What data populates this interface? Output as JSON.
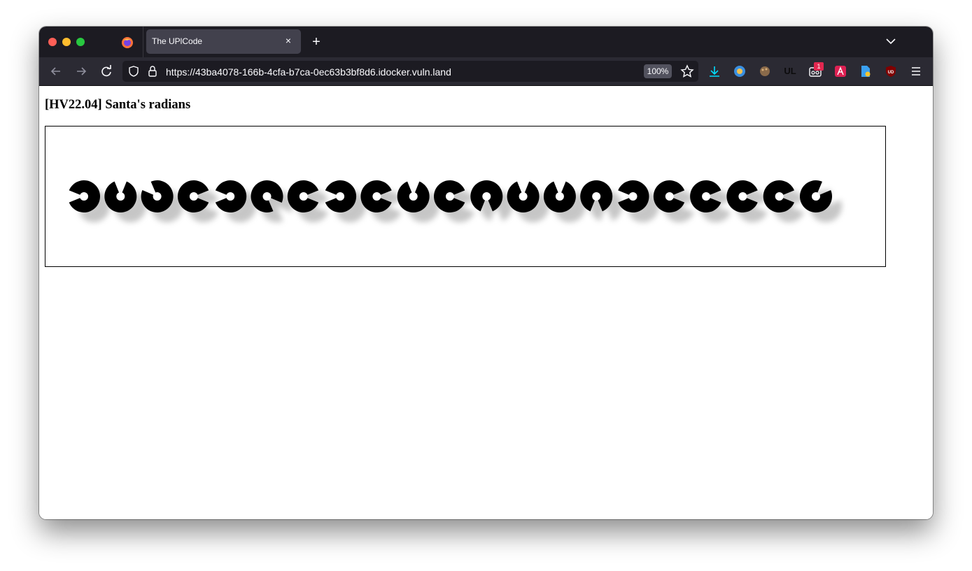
{
  "browser": {
    "tab_title": "The UPlCode",
    "new_tab_label": "+",
    "close_label": "×",
    "url": "https://43ba4078-166b-4cfa-b7ca-0ec63b3bf8d6.idocker.vuln.land",
    "zoom": "100%",
    "extensions": [
      {
        "name": "downloads-icon",
        "color": "#00ddff"
      },
      {
        "name": "world-globe-icon",
        "color": "#3b8fe0"
      },
      {
        "name": "palette-icon",
        "color": "#8a6a4a"
      },
      {
        "name": "ul-extension-icon",
        "label": "UL"
      },
      {
        "name": "cassette-icon",
        "badge": "1"
      },
      {
        "name": "angular-extension-icon",
        "color": "#dd2153"
      },
      {
        "name": "file-search-icon",
        "color": "#3aa0f0"
      },
      {
        "name": "ublock-icon",
        "label": "UD",
        "color": "#800000"
      }
    ]
  },
  "page": {
    "title": "[HV22.04] Santa's radians"
  },
  "glyphs": {
    "count": 21,
    "shadow_color": "#999999",
    "fill_color": "#000000",
    "gap_angles_deg": [
      180,
      90,
      135,
      0,
      180,
      315,
      0,
      180,
      0,
      90,
      0,
      270,
      90,
      90,
      270,
      180,
      0,
      0,
      0,
      0,
      45
    ]
  }
}
